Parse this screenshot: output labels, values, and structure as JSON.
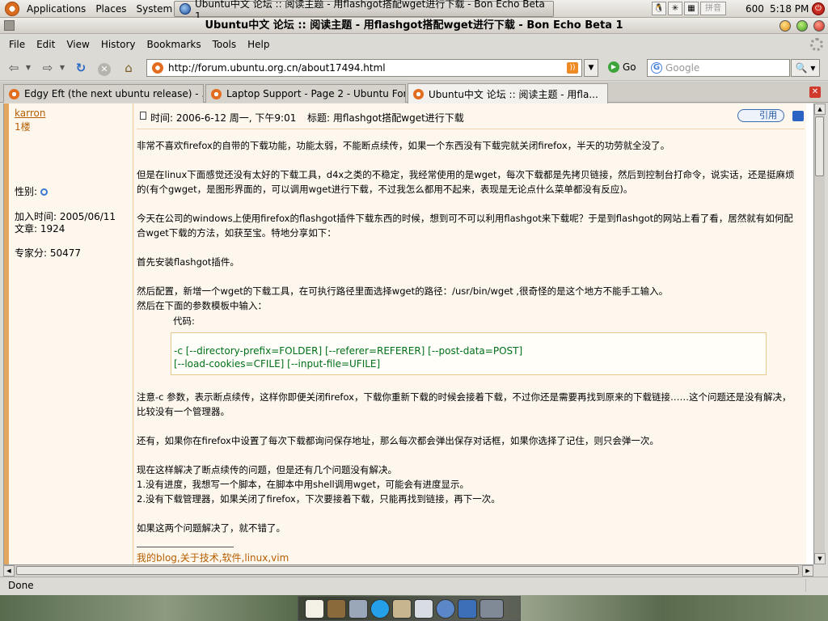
{
  "panel": {
    "applications": "Applications",
    "places": "Places",
    "system": "System",
    "task_title": "Ubuntu中文 论坛 :: 阅读主题 - 用flashgot搭配wget进行下载 - Bon Echo Beta 1",
    "ime_label": "拼音",
    "cpu": "600",
    "clock": "5:18 PM"
  },
  "window": {
    "title": "Ubuntu中文 论坛 :: 阅读主题 - 用flashgot搭配wget进行下载 - Bon Echo Beta 1"
  },
  "menu": [
    "File",
    "Edit",
    "View",
    "History",
    "Bookmarks",
    "Tools",
    "Help"
  ],
  "nav": {
    "url": "http://forum.ubuntu.org.cn/about17494.html",
    "go_label": "Go",
    "search_placeholder": "Google"
  },
  "tabs": [
    {
      "label": "Edgy Eft (the next ubuntu release) - ..."
    },
    {
      "label": "Laptop Support - Page 2 - Ubuntu For..."
    },
    {
      "label": "Ubuntu中文 论坛 :: 阅读主题 - 用fla..."
    }
  ],
  "user": {
    "name": "karron",
    "floor": "1楼",
    "gender_label": "性别:",
    "join_date": "加入时间: 2005/06/11",
    "posts": "文章: 1924",
    "score": "专家分: 50477"
  },
  "post": {
    "time": "时间: 2006-6-12 周一, 下午9:01",
    "subject": "标题: 用flashgot搭配wget进行下载",
    "quote_label": "引用",
    "paragraphs": [
      "非常不喜欢firefox的自带的下载功能，功能太弱，不能断点续传，如果一个东西没有下载完就关闭firefox，半天的功劳就全没了。",
      "但是在linux下面感觉还没有太好的下载工具，d4x之类的不稳定，我经常使用的是wget，每次下载都是先拷贝链接，然后到控制台打命令，说实话，还是挺麻烦的(有个gwget，是图形界面的，可以调用wget进行下载，不过我怎么都用不起来，表现是无论点什么菜单都没有反应)。",
      "今天在公司的windows上使用firefox的flashgot插件下载东西的时候，想到可不可以利用flashgot来下载呢？于是到flashgot的网站上看了看，居然就有如何配合wget下载的方法，如获至宝。特地分享如下：",
      "首先安装flashgot插件。",
      "然后配置，新增一个wget的下载工具，在可执行路径里面选择wget的路径：/usr/bin/wget ,很奇怪的是这个地方不能手工输入。",
      "然后在下面的参数模板中输入："
    ],
    "code_label": "代码:",
    "code_line1": "-c [--directory-prefix=FOLDER] [--referer=REFERER] [--post-data=POST]",
    "code_line2": "[--load-cookies=CFILE] [--input-file=UFILE]",
    "after": [
      "注意-c 参数，表示断点续传，这样你即便关闭firefox，下载你重新下载的时候会接着下载，不过你还是需要再找到原来的下载链接……这个问题还是没有解决，比较没有一个管理器。",
      "还有，如果你在firefox中设置了每次下载都询问保存地址，那么每次都会弹出保存对话框，如果你选择了记住，则只会弹一次。",
      "现在这样解决了断点续传的问题，但是还有几个问题没有解决。",
      "1.没有进度，我想写一个脚本，在脚本中用shell调用wget，可能会有进度显示。",
      "2.没有下载管理器，如果关闭了firefox，下次要接着下载，只能再找到链接，再下一次。",
      "如果这两个问题解决了，就不错了。"
    ],
    "signature": "我的blog,关于技术,软件,linux,vim"
  },
  "status": {
    "text": "Done"
  }
}
